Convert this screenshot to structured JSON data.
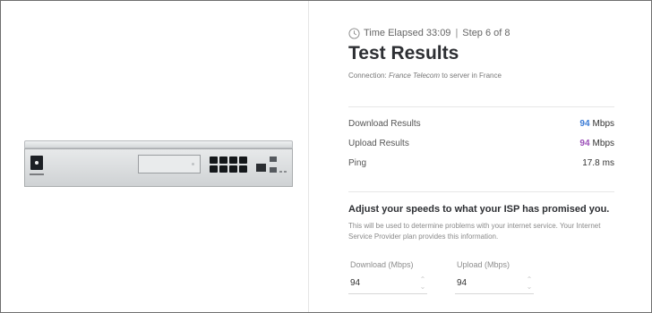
{
  "status": {
    "time_elapsed": "Time Elapsed 33:09",
    "separator": "|",
    "step": "Step 6 of 8"
  },
  "title": "Test Results",
  "connection": {
    "prefix": "Connection:",
    "isp": "France Telecom",
    "to": "to",
    "server": "server in  France"
  },
  "results": [
    {
      "label": "Download Results",
      "value": "94",
      "unit": "Mbps"
    },
    {
      "label": "Upload Results",
      "value": "94",
      "unit": "Mbps"
    },
    {
      "label": "Ping",
      "value": "17.8",
      "unit": "ms"
    }
  ],
  "adjust": {
    "heading": "Adjust your speeds to what your ISP has promised you.",
    "description": "This will be used to determine problems with your internet service. Your Internet Service Provider plan provides this information."
  },
  "fields": {
    "download": {
      "label": "Download (Mbps)",
      "value": "94"
    },
    "upload": {
      "label": "Upload (Mbps)",
      "value": "94"
    }
  },
  "colors": {
    "download_value": "#3a7bd5",
    "upload_value": "#9b4fb8"
  },
  "icons": {
    "clock": "clock-icon",
    "stepper": "stepper-icon"
  }
}
